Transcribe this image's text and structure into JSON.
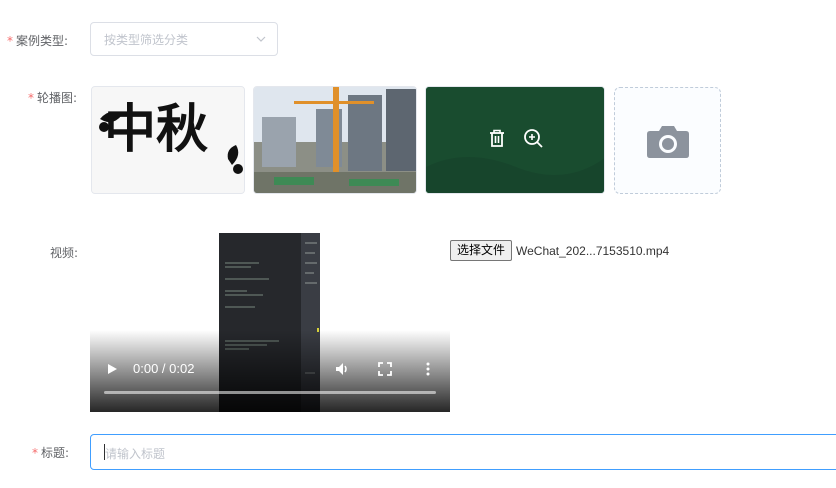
{
  "form": {
    "case_type": {
      "required_mark": "*",
      "label": "案例类型:",
      "placeholder": "按类型筛选分类"
    },
    "carousel": {
      "required_mark": "*",
      "label": "轮播图:",
      "images": [
        {
          "name": "mid-autumn-calligraphy",
          "text": "中秋"
        },
        {
          "name": "construction-site-photo"
        },
        {
          "name": "green-board-image",
          "hovered": true
        }
      ],
      "overlay_icons": [
        "delete-icon",
        "zoom-in-icon"
      ],
      "upload_icon": "camera-icon"
    },
    "video": {
      "label": "视频:",
      "time": "0:00 / 0:02",
      "progress": 0,
      "controls": [
        "play-icon",
        "volume-icon",
        "fullscreen-icon",
        "more-icon"
      ],
      "file_button": "选择文件",
      "file_name": "WeChat_202...7153510.mp4"
    },
    "title": {
      "required_mark": "*",
      "label": "标题:",
      "placeholder": "请输入标题",
      "value": ""
    }
  },
  "colors": {
    "required": "#f56c6c",
    "focus_border": "#409eff",
    "placeholder": "#c0c4cc",
    "label": "#606266"
  }
}
